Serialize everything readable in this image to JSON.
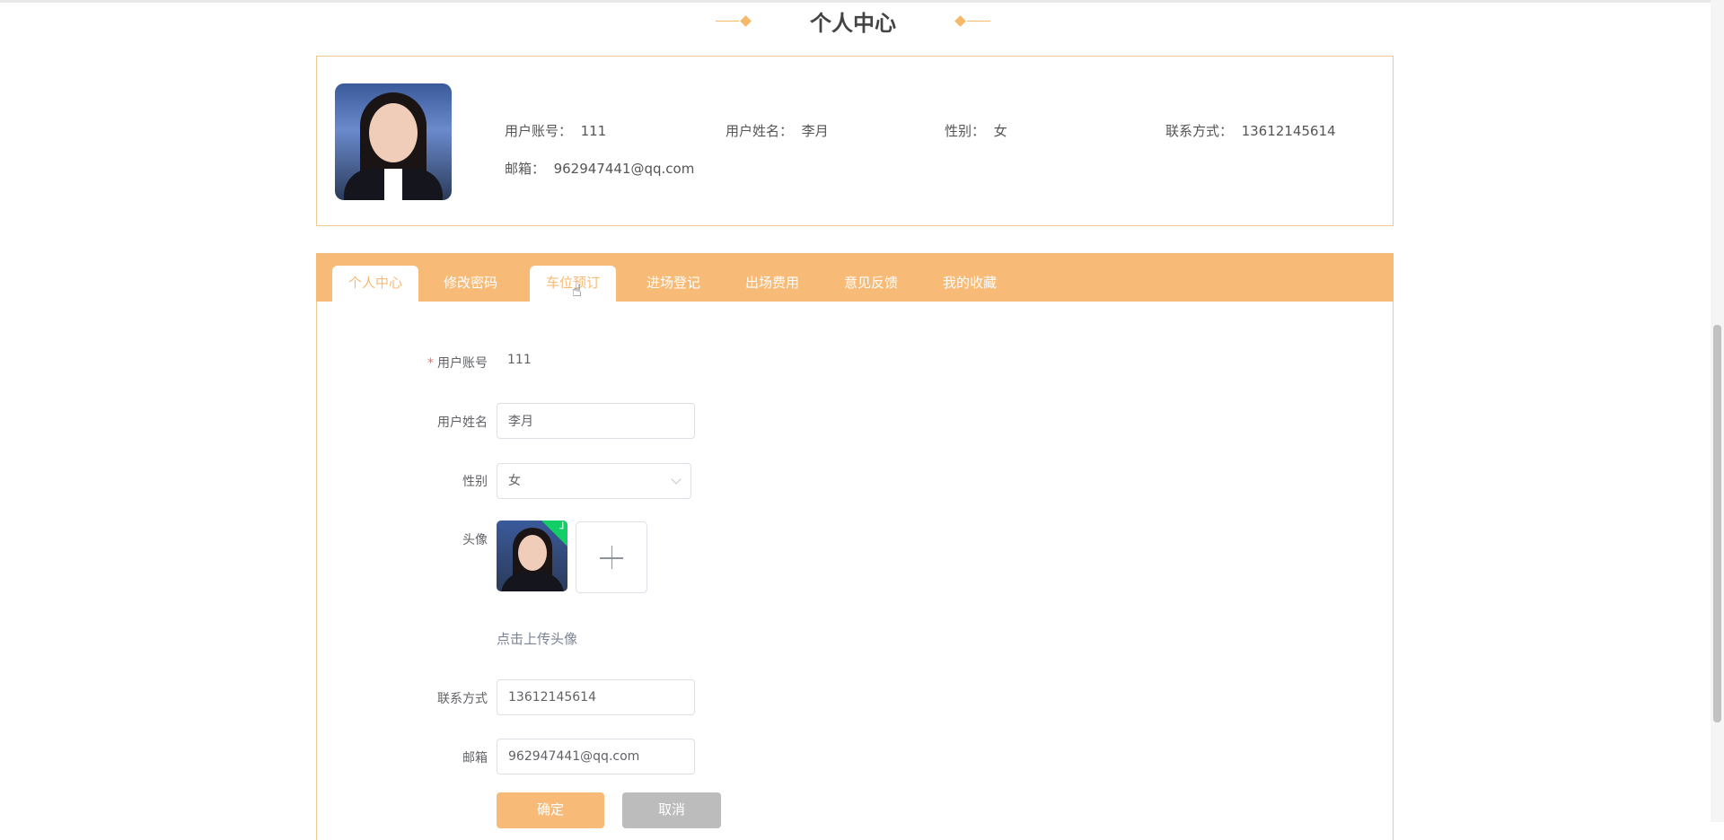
{
  "header": {
    "title": "个人中心"
  },
  "profile": {
    "account_label": "用户账号：",
    "account": "111",
    "name_label": "用户姓名：",
    "name": "李月",
    "gender_label": "性别：",
    "gender": "女",
    "phone_label": "联系方式：",
    "phone": "13612145614",
    "email_label": "邮箱：",
    "email": "962947441@qq.com"
  },
  "tabs": [
    {
      "label": "个人中心"
    },
    {
      "label": "修改密码"
    },
    {
      "label": "车位预订"
    },
    {
      "label": "进场登记"
    },
    {
      "label": "出场费用"
    },
    {
      "label": "意见反馈"
    },
    {
      "label": "我的收藏"
    }
  ],
  "form": {
    "account_label": "用户账号",
    "account": "111",
    "name_label": "用户姓名",
    "name": "李月",
    "gender_label": "性别",
    "gender": "女",
    "avatar_label": "头像",
    "upload_link": "点击上传头像",
    "phone_label": "联系方式",
    "phone": "13612145614",
    "email_label": "邮箱",
    "email": "962947441@qq.com",
    "confirm": "确定",
    "cancel": "取消"
  },
  "colors": {
    "accent": "#f8bb77",
    "cancel": "#bcbcbc",
    "success": "#13ce66"
  }
}
